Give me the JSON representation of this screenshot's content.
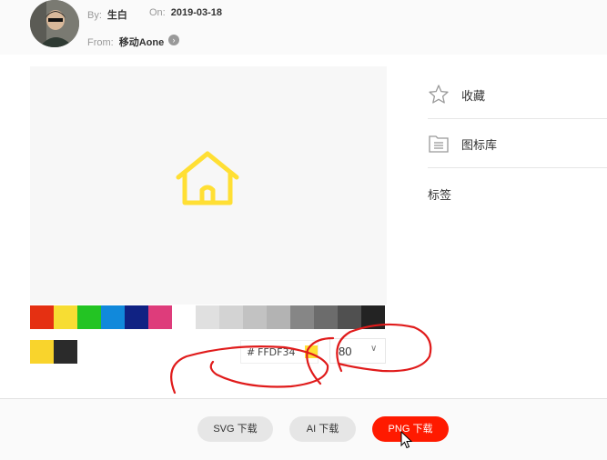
{
  "author": {
    "by_label": "By:",
    "name": "生白",
    "on_label": "On:",
    "date": "2019-03-18",
    "from_label": "From:",
    "source": "移动Aone"
  },
  "preview": {
    "icon": "home-icon",
    "icon_color": "#FFDF34"
  },
  "palette": [
    "#e53012",
    "#f7dd33",
    "#23c423",
    "#1189db",
    "#102283",
    "#de3c7b",
    "#ffffff",
    "#e0e0e0",
    "#d3d3d3",
    "#c2c2c2",
    "#b3b3b3",
    "#868686",
    "#6c6c6c",
    "#505050",
    "#232323"
  ],
  "recent_colors": [
    "#f9d42c",
    "#2b2b2b"
  ],
  "color_input": {
    "hash": "#",
    "value": "FFDF34"
  },
  "size_select": {
    "value": "80"
  },
  "sidebar": {
    "collect_label": "收藏",
    "collect_icon": "star-icon",
    "library_label": "图标库",
    "library_icon": "library-icon",
    "tags_label": "标签"
  },
  "downloads": {
    "svg_label": "SVG 下载",
    "ai_label": "AI 下载",
    "png_label": "PNG 下载"
  },
  "colors": {
    "accent": "#ff1a00",
    "annotation": "#e01b1b"
  }
}
